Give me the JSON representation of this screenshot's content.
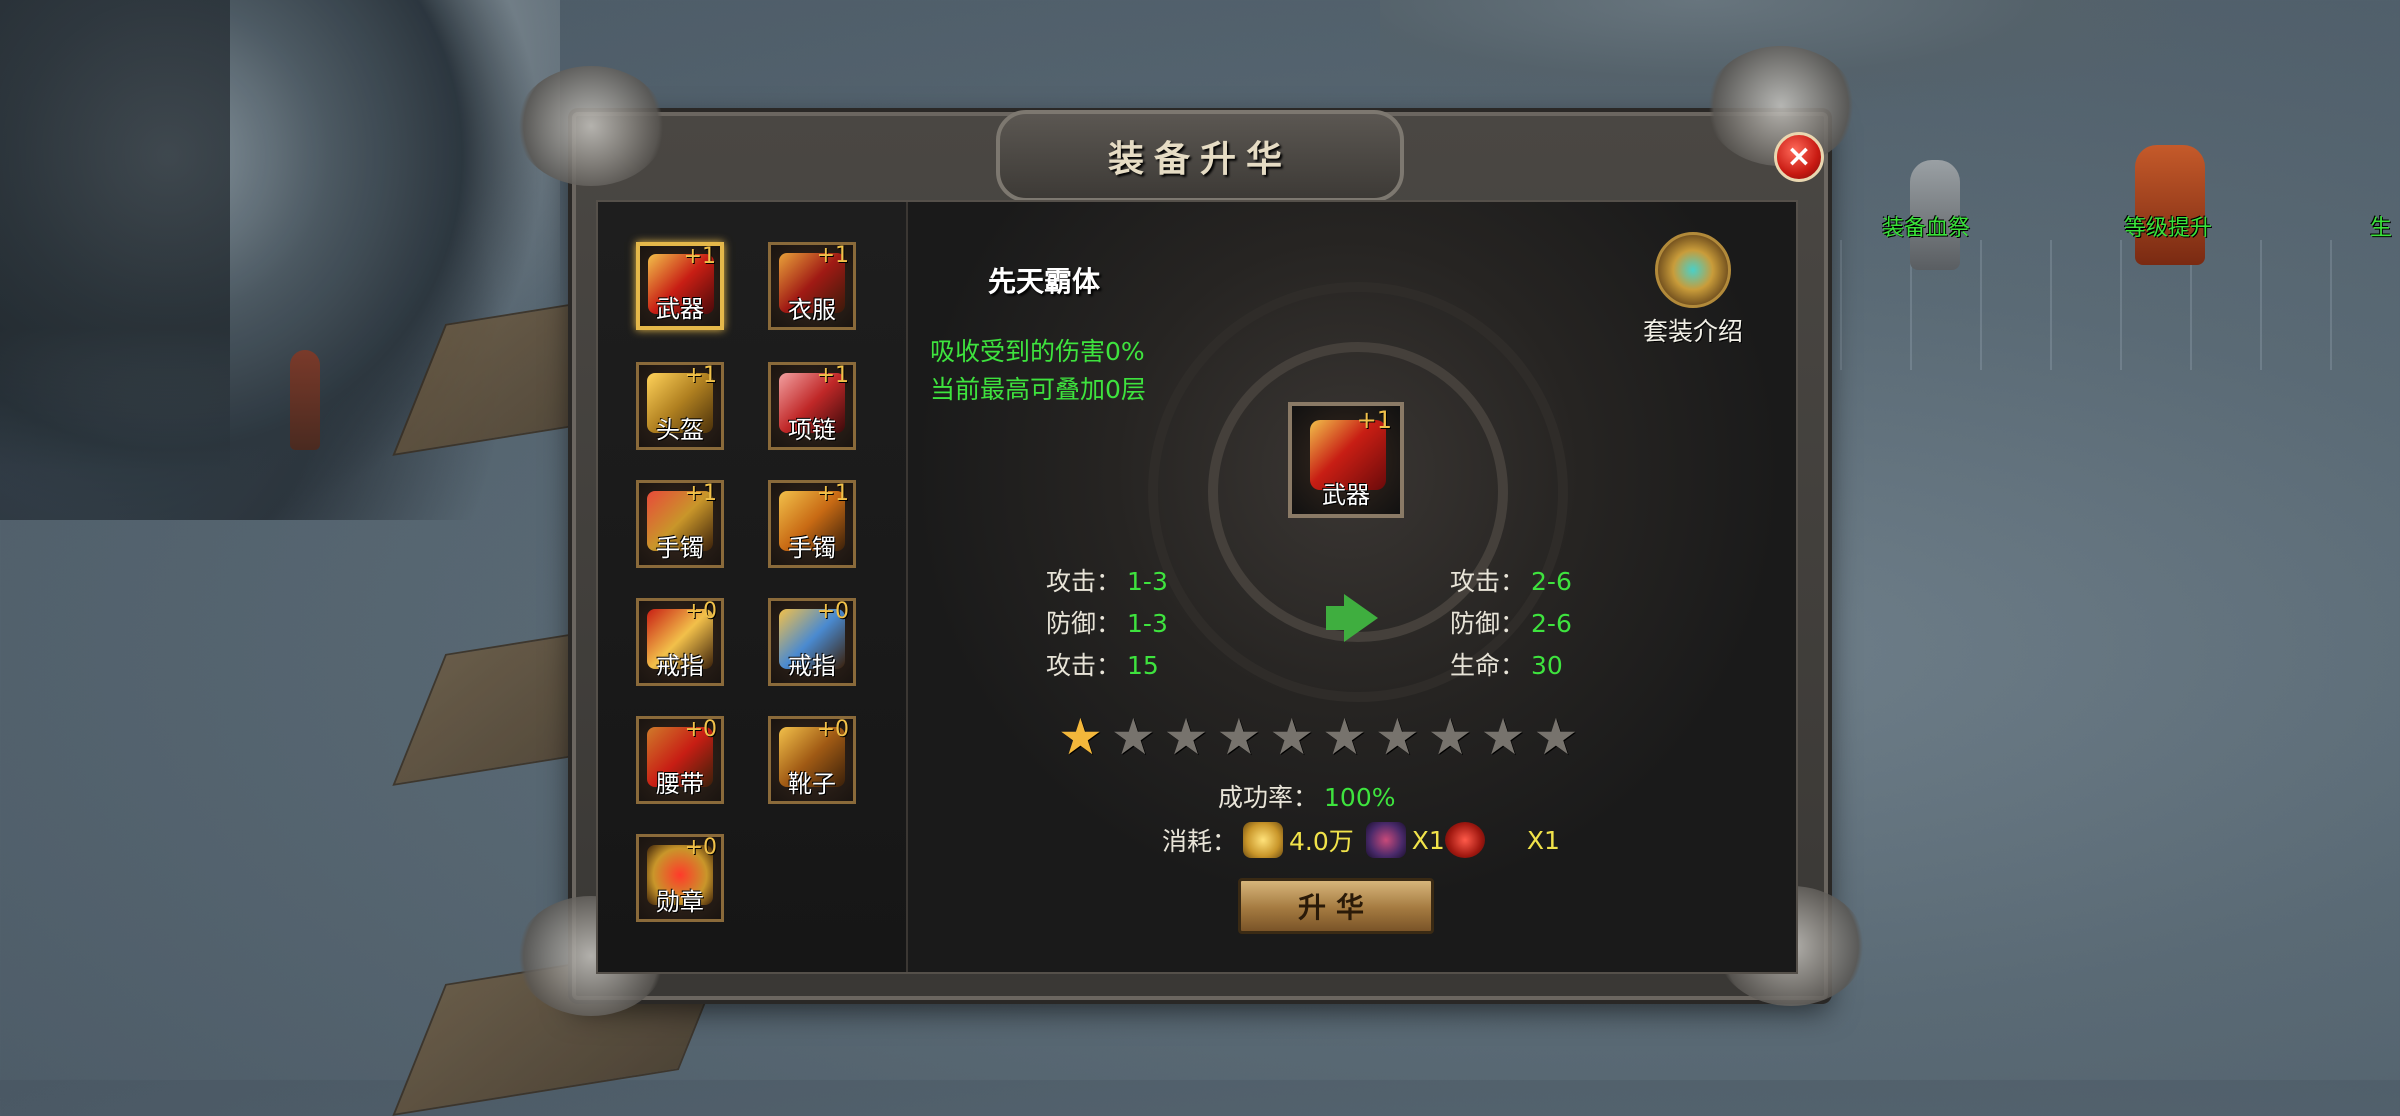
{
  "dialog": {
    "title": "装备升华",
    "close_icon": "×"
  },
  "world_labels": {
    "npc1": "装备血祭",
    "npc2": "等级提升",
    "edge": "生"
  },
  "slots": [
    {
      "name": "武器",
      "plus": "+1",
      "selected": true
    },
    {
      "name": "衣服",
      "plus": "+1"
    },
    {
      "name": "头盔",
      "plus": "+1"
    },
    {
      "name": "项链",
      "plus": "+1"
    },
    {
      "name": "手镯",
      "plus": "+1"
    },
    {
      "name": "手镯",
      "plus": "+1"
    },
    {
      "name": "戒指",
      "plus": "+0"
    },
    {
      "name": "戒指",
      "plus": "+0"
    },
    {
      "name": "腰带",
      "plus": "+0"
    },
    {
      "name": "靴子",
      "plus": "+0"
    },
    {
      "name": "勋章",
      "plus": "+0"
    }
  ],
  "set": {
    "name": "先天霸体",
    "desc1": "吸收受到的伤害0%",
    "desc2": "当前最高可叠加0层",
    "suit_label": "套装介绍"
  },
  "selected_item": {
    "name": "武器",
    "plus": "+1"
  },
  "stats_before": [
    {
      "label": "攻击：",
      "value": "1-3"
    },
    {
      "label": "防御：",
      "value": "1-3"
    },
    {
      "label": "攻击：",
      "value": "15"
    }
  ],
  "stats_after": [
    {
      "label": "攻击：",
      "value": "2-6"
    },
    {
      "label": "防御：",
      "value": "2-6"
    },
    {
      "label": "生命：",
      "value": "30"
    }
  ],
  "stars": {
    "total": 10,
    "filled": 1
  },
  "rate": {
    "label": "成功率：",
    "value": "100%"
  },
  "cost": {
    "label": "消耗：",
    "gold": "4.0万",
    "item1": "X1",
    "item2": "X1"
  },
  "upgrade_button": "升华",
  "colors": {
    "green": "#3ee33e",
    "gold": "#f1c14a",
    "star_on": "#f3b73b",
    "star_off": "#77736d"
  }
}
